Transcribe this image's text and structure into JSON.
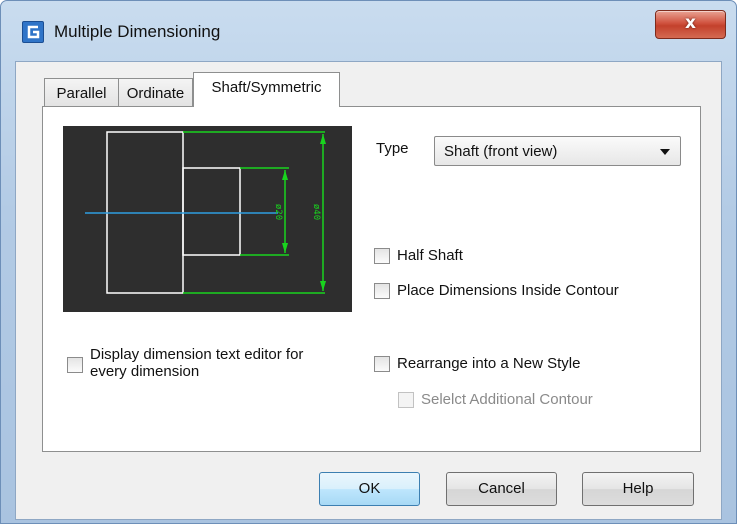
{
  "window": {
    "title": "Multiple Dimensioning",
    "close_glyph": "x"
  },
  "tabs": [
    {
      "label": "Parallel"
    },
    {
      "label": "Ordinate"
    },
    {
      "label": "Shaft/Symmetric"
    }
  ],
  "active_tab": "Shaft/Symmetric",
  "preview": {
    "dim_inner": "ø20",
    "dim_outer": "ø40"
  },
  "type_field": {
    "label": "Type",
    "value": "Shaft (front view)"
  },
  "options": {
    "half_shaft": {
      "label": "Half Shaft",
      "checked": false
    },
    "place_inside": {
      "label": "Place Dimensions Inside Contour",
      "checked": false
    },
    "display_editor": {
      "label_line1": "Display dimension text editor for",
      "label_line2": "every dimension",
      "checked": false
    },
    "rearrange": {
      "label": "Rearrange into a New Style",
      "checked": false
    },
    "select_additional": {
      "label": "Selelct Additional Contour",
      "checked": false,
      "enabled": false
    }
  },
  "buttons": {
    "ok": "OK",
    "cancel": "Cancel",
    "help": "Help"
  },
  "colors": {
    "preview_bg": "#2e2e2e",
    "contour": "#ffffff",
    "dimension": "#19d41e",
    "centerline": "#2f9ee0"
  }
}
